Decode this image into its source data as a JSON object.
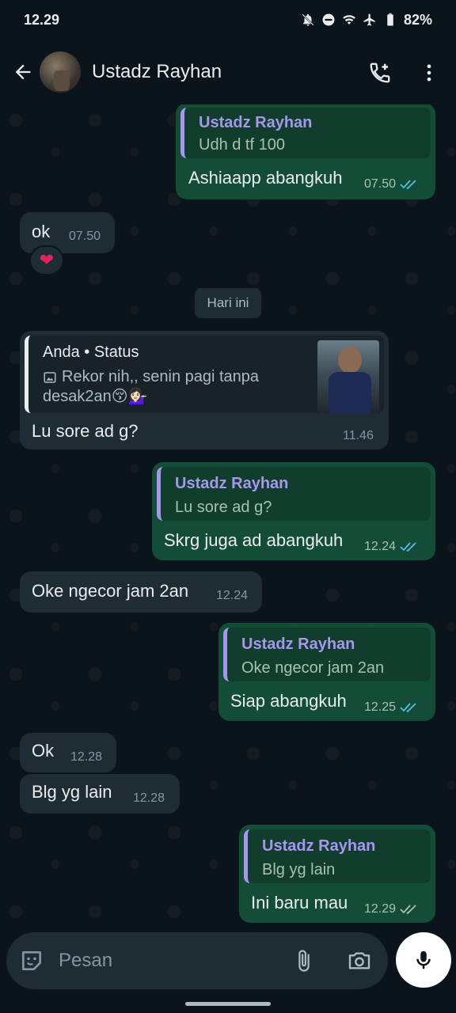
{
  "status_bar": {
    "time": "12.29",
    "battery": "82%"
  },
  "header": {
    "contact_name": "Ustadz Rayhan"
  },
  "date_divider": "Hari ini",
  "messages": [
    {
      "dir": "out",
      "quote": {
        "name": "Ustadz Rayhan",
        "text": "Udh d tf 100"
      },
      "text": "Ashiaapp abangkuh",
      "time": "07.50",
      "status": "read"
    },
    {
      "dir": "in",
      "text": "ok",
      "time": "07.50",
      "reaction": "❤"
    },
    {
      "dir": "in",
      "quote": {
        "name": "Anda • Status",
        "text": "Rekor nih,, senin pagi tanpa desak2an😚💁🏻‍♀️",
        "thumbnail": "status-photo"
      },
      "text": "Lu sore ad g?",
      "time": "11.46"
    },
    {
      "dir": "out",
      "quote": {
        "name": "Ustadz Rayhan",
        "text": "Lu sore ad g?"
      },
      "text": "Skrg juga ad abangkuh",
      "time": "12.24",
      "status": "read"
    },
    {
      "dir": "in",
      "text": "Oke ngecor jam 2an",
      "time": "12.24"
    },
    {
      "dir": "out",
      "quote": {
        "name": "Ustadz Rayhan",
        "text": "Oke ngecor jam 2an"
      },
      "text": "Siap abangkuh",
      "time": "12.25",
      "status": "read"
    },
    {
      "dir": "in",
      "text": "Ok",
      "time": "12.28"
    },
    {
      "dir": "in",
      "text": "Blg yg lain",
      "time": "12.28"
    },
    {
      "dir": "out",
      "quote": {
        "name": "Ustadz Rayhan",
        "text": "Blg yg lain"
      },
      "text": "Ini baru mau",
      "time": "12.29",
      "status": "delivered"
    }
  ],
  "composer": {
    "placeholder": "Pesan"
  },
  "colors": {
    "read_tick": "#53bdeb",
    "delivered_tick": "#a8c1b7",
    "outgoing_bubble": "#144d37",
    "incoming_bubble": "#1f2c34",
    "quote_accent": "#a895f0"
  },
  "icons": [
    "back-arrow-icon",
    "add-call-icon",
    "more-vert-icon",
    "emoji-icon",
    "attach-icon",
    "camera-icon",
    "mic-icon",
    "image-icon",
    "double-tick-icon",
    "heart-icon"
  ]
}
